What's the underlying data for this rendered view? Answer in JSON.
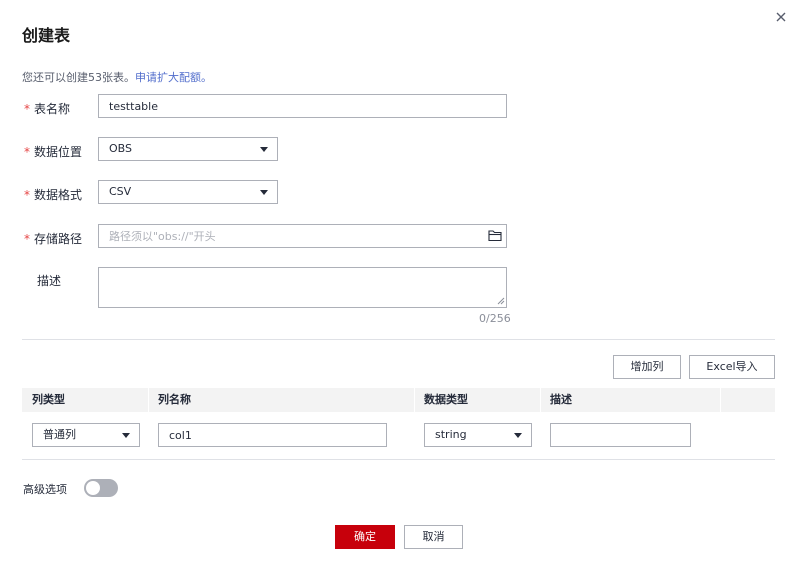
{
  "dialog": {
    "title": "创建表",
    "quota_text": "您还可以创建53张表。",
    "quota_link": "申请扩大配额。"
  },
  "form": {
    "required_mark": "*",
    "table_name": {
      "label": "表名称",
      "value": "testtable"
    },
    "data_location": {
      "label": "数据位置",
      "value": "OBS"
    },
    "data_format": {
      "label": "数据格式",
      "value": "CSV"
    },
    "storage_path": {
      "label": "存储路径",
      "value": "",
      "placeholder": "路径须以\"obs://\"开头"
    },
    "description": {
      "label": "描述",
      "value": "",
      "counter": "0/256"
    }
  },
  "columns": {
    "add_label": "增加列",
    "import_label": "Excel导入",
    "headers": [
      "列类型",
      "列名称",
      "数据类型",
      "描述"
    ],
    "rows": [
      {
        "col_type": "普通列",
        "col_name": "col1",
        "data_type": "string",
        "description": ""
      }
    ]
  },
  "advanced": {
    "label": "高级选项",
    "enabled": false
  },
  "footer": {
    "confirm_label": "确定",
    "cancel_label": "取消"
  },
  "colors": {
    "primary": "#c7000b",
    "link": "#526ecc",
    "required": "#e54545",
    "border": "#adb0b8"
  },
  "icons": {
    "close": "close-icon",
    "folder": "folder-icon",
    "caret": "caret-down-icon",
    "resize": "resize-handle-icon"
  }
}
